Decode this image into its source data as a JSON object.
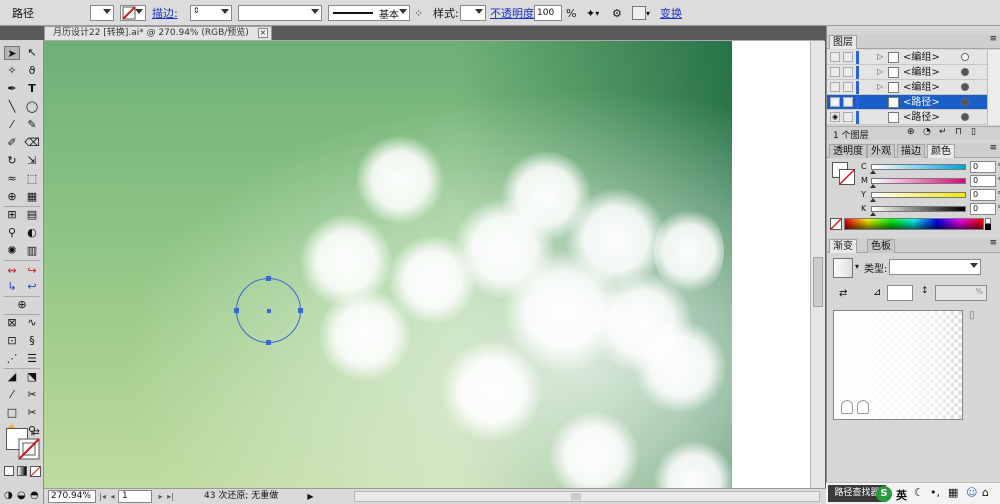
{
  "control_bar": {
    "object_type": "路径",
    "stroke_label": "描边:",
    "stroke_profile": "基本",
    "style_label": "样式:",
    "opacity_label": "不透明度",
    "opacity_value": "100",
    "opacity_unit": "%",
    "transform_label": "变换"
  },
  "document_tab": {
    "title": "月历设计22 [转换].ai* @ 270.94% (RGB/预览)",
    "close": "×"
  },
  "status_bar": {
    "zoom": "270.94%",
    "page": "1",
    "undo_text": "43 次还原; 无重做"
  },
  "layers_panel": {
    "title": "图层",
    "rows": [
      {
        "name": "<编组>",
        "expandable": true,
        "selected": false,
        "dot_filled": false
      },
      {
        "name": "<编组>",
        "expandable": true,
        "selected": false,
        "dot_filled": true
      },
      {
        "name": "<编组>",
        "expandable": true,
        "selected": false,
        "dot_filled": true
      },
      {
        "name": "<路径>",
        "expandable": false,
        "selected": true,
        "dot_filled": true
      },
      {
        "name": "<路径>",
        "expandable": false,
        "selected": false,
        "dot_filled": true
      }
    ],
    "footer_count": "1 个图层"
  },
  "color_panel": {
    "tabs": [
      "透明度",
      "外观",
      "描边",
      "颜色"
    ],
    "active_tab": "颜色",
    "channels": [
      {
        "label": "C",
        "value": "0",
        "unit": "%"
      },
      {
        "label": "M",
        "value": "0",
        "unit": "%"
      },
      {
        "label": "Y",
        "value": "0",
        "unit": "%"
      },
      {
        "label": "K",
        "value": "0",
        "unit": "%"
      }
    ]
  },
  "gradient_panel": {
    "tabs": [
      "渐变",
      "色板"
    ],
    "active_tab": "渐变",
    "type_label": "类型:",
    "type_value": "",
    "ratio_unit": "%"
  },
  "taskbar": {
    "path_finder": "路径查找器",
    "ime_lang": "英",
    "ime_icons": [
      "moon-icon",
      "punctuation-icon",
      "keyboard-icon",
      "user-icon",
      "shirt-icon"
    ]
  },
  "colors": {
    "selection_blue": "#3b67d6",
    "link_blue": "#1b33c8",
    "layer_selected": "#1a5fc7",
    "canvas_dark_green": "#1a6941"
  }
}
